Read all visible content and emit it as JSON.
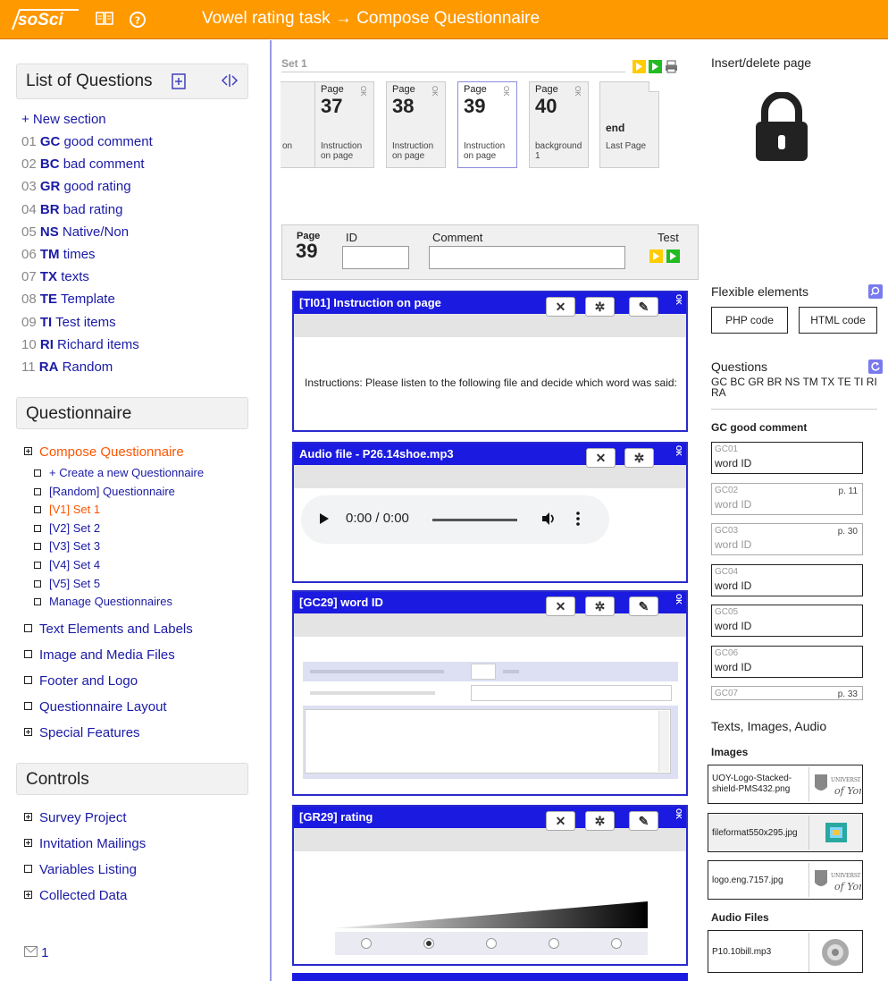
{
  "topbar": {
    "logo": "soSci",
    "title": "Vowel rating task → Compose Questionnaire",
    "icons": [
      "book-icon",
      "help-icon"
    ]
  },
  "list_of_questions": {
    "title": "List of Questions",
    "new_section": "+ New section",
    "items": [
      {
        "num": "01",
        "code": "GC",
        "label": "good comment"
      },
      {
        "num": "02",
        "code": "BC",
        "label": "bad comment"
      },
      {
        "num": "03",
        "code": "GR",
        "label": "good rating"
      },
      {
        "num": "04",
        "code": "BR",
        "label": "bad rating"
      },
      {
        "num": "05",
        "code": "NS",
        "label": "Native/Non"
      },
      {
        "num": "06",
        "code": "TM",
        "label": "times"
      },
      {
        "num": "07",
        "code": "TX",
        "label": "texts"
      },
      {
        "num": "08",
        "code": "TE",
        "label": "Template"
      },
      {
        "num": "09",
        "code": "TI",
        "label": "Test items"
      },
      {
        "num": "10",
        "code": "RI",
        "label": "Richard items"
      },
      {
        "num": "11",
        "code": "RA",
        "label": "Random"
      }
    ]
  },
  "questionnaire": {
    "title": "Questionnaire",
    "compose": "Compose Questionnaire",
    "sub": [
      "+ Create a new Questionnaire",
      "[Random] Questionnaire",
      "[V1] Set 1",
      "[V2] Set 2",
      "[V3] Set 3",
      "[V4] Set 4",
      "[V5] Set 5",
      "Manage Questionnaires"
    ],
    "sections": [
      "Text Elements and Labels",
      "Image and Media Files",
      "Footer and Logo",
      "Questionnaire Layout",
      "Special Features"
    ]
  },
  "controls": {
    "title": "Controls",
    "items": [
      "Survey Project",
      "Invitation Mailings",
      "Variables Listing",
      "Collected Data"
    ],
    "mail_count": "1"
  },
  "set": {
    "label": "Set 1",
    "pages": [
      {
        "label": "",
        "num": "",
        "desc": "on",
        "partial": true
      },
      {
        "label": "Page",
        "num": "37",
        "desc": "Instruction on page"
      },
      {
        "label": "Page",
        "num": "38",
        "desc": "Instruction on page"
      },
      {
        "label": "Page",
        "num": "39",
        "desc": "Instruction on page"
      },
      {
        "label": "Page",
        "num": "40",
        "desc": "background 1"
      },
      {
        "label": "",
        "num": "end",
        "desc": "Last Page"
      }
    ]
  },
  "page_head": {
    "page_label": "Page",
    "page_num": "39",
    "id_label": "ID",
    "comment_label": "Comment",
    "test_label": "Test"
  },
  "blocks": {
    "b1_title": "[TI01] Instruction on page",
    "b1_text": "Instructions: Please listen to the following file and decide which word was said:",
    "b2_title": "Audio file - P26.14shoe.mp3",
    "b2_time": "0:00 / 0:00",
    "b3_title": "[GC29] word ID",
    "b4_title": "[GR29] rating",
    "ok": "OK"
  },
  "right": {
    "insert_delete": "Insert/delete page",
    "flexible": "Flexible elements",
    "php": "PHP code",
    "html": "HTML code",
    "questions": "Questions",
    "questions_codes": "GC BC GR BR NS TM TX TE TI RI RA",
    "gc_header": "GC good comment",
    "qcards": [
      {
        "id": "GC01",
        "name": "word ID",
        "page": "",
        "dim": false
      },
      {
        "id": "GC02",
        "name": "word ID",
        "page": "p. 11",
        "dim": true
      },
      {
        "id": "GC03",
        "name": "word ID",
        "page": "p. 30",
        "dim": true
      },
      {
        "id": "GC04",
        "name": "word ID",
        "page": "",
        "dim": false
      },
      {
        "id": "GC05",
        "name": "word ID",
        "page": "",
        "dim": false
      },
      {
        "id": "GC06",
        "name": "word ID",
        "page": "",
        "dim": false
      },
      {
        "id": "GC07",
        "name": "",
        "page": "p. 33",
        "dim": true
      }
    ],
    "texts_images_audio": "Texts, Images, Audio",
    "images_label": "Images",
    "images": [
      "UOY-Logo-Stacked-shield-PMS432.png",
      "fileformat550x295.jpg",
      "logo.eng.7157.jpg"
    ],
    "audio_label": "Audio Files",
    "audio": [
      "P10.10bill.mp3"
    ]
  },
  "colors": {
    "accent": "#ff9900",
    "link": "#1a1aa6",
    "block_header": "#1a1ae0",
    "active": "#ff5500"
  }
}
